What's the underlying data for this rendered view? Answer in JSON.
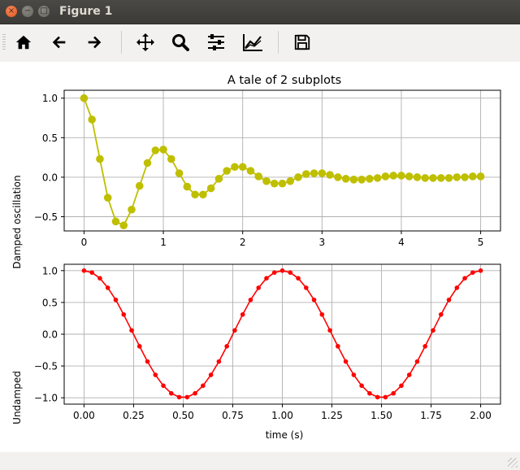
{
  "window": {
    "title": "Figure 1",
    "close_icon": "×",
    "minimize_icon": "−",
    "maximize_icon": "□"
  },
  "toolbar": {
    "buttons": [
      {
        "name": "home",
        "icon": "home-icon"
      },
      {
        "name": "back",
        "icon": "arrow-left-icon"
      },
      {
        "name": "forward",
        "icon": "arrow-right-icon"
      },
      {
        "name": "pan",
        "icon": "move-icon"
      },
      {
        "name": "zoom",
        "icon": "magnifier-icon"
      },
      {
        "name": "subplots",
        "icon": "sliders-icon"
      },
      {
        "name": "edit-axis",
        "icon": "line-chart-icon"
      },
      {
        "name": "save",
        "icon": "floppy-disk-icon"
      }
    ]
  },
  "statusbar": {
    "text": ""
  },
  "chart_data": [
    {
      "type": "line",
      "title": "A tale of 2 subplots",
      "xlabel": "",
      "ylabel": "Damped oscillation",
      "xlim": [
        -0.25,
        5.25
      ],
      "ylim": [
        -0.68,
        1.1
      ],
      "xticks": [
        0,
        1,
        2,
        3,
        4,
        5
      ],
      "xtick_labels": [
        "0",
        "1",
        "2",
        "3",
        "4",
        "5"
      ],
      "yticks": [
        -0.5,
        0.0,
        0.5,
        1.0
      ],
      "ytick_labels": [
        "−0.5",
        "0.0",
        "0.5",
        "1.0"
      ],
      "grid": true,
      "color": "#bfbf00",
      "marker": "circle-large",
      "x": [
        0,
        0.1,
        0.2,
        0.3,
        0.4,
        0.5,
        0.6,
        0.7,
        0.8,
        0.9,
        1.0,
        1.1,
        1.2,
        1.3,
        1.4,
        1.5,
        1.6,
        1.7,
        1.8,
        1.9,
        2.0,
        2.1,
        2.2,
        2.3,
        2.4,
        2.5,
        2.6,
        2.7,
        2.8,
        2.9,
        3.0,
        3.1,
        3.2,
        3.3,
        3.4,
        3.5,
        3.6,
        3.7,
        3.8,
        3.9,
        4.0,
        4.1,
        4.2,
        4.3,
        4.4,
        4.5,
        4.6,
        4.7,
        4.8,
        4.9,
        5.0
      ],
      "y": [
        1.0,
        0.73,
        0.23,
        -0.26,
        -0.56,
        -0.61,
        -0.41,
        -0.11,
        0.18,
        0.34,
        0.35,
        0.23,
        0.05,
        -0.12,
        -0.22,
        -0.22,
        -0.14,
        -0.02,
        0.08,
        0.13,
        0.13,
        0.08,
        0.01,
        -0.05,
        -0.08,
        -0.08,
        -0.05,
        0.0,
        0.04,
        0.05,
        0.05,
        0.03,
        0.0,
        -0.02,
        -0.03,
        -0.03,
        -0.02,
        -0.01,
        0.01,
        0.02,
        0.02,
        0.01,
        0.0,
        -0.01,
        -0.01,
        -0.01,
        -0.01,
        0.0,
        0.0,
        0.01,
        0.01
      ]
    },
    {
      "type": "line",
      "title": "",
      "xlabel": "time (s)",
      "ylabel": "Undamped",
      "xlim": [
        -0.1,
        2.1
      ],
      "ylim": [
        -1.1,
        1.1
      ],
      "xticks": [
        0,
        0.25,
        0.5,
        0.75,
        1.0,
        1.25,
        1.5,
        1.75,
        2.0
      ],
      "xtick_labels": [
        "0.00",
        "0.25",
        "0.50",
        "0.75",
        "1.00",
        "1.25",
        "1.50",
        "1.75",
        "2.00"
      ],
      "yticks": [
        -1.0,
        -0.5,
        0.0,
        0.5,
        1.0
      ],
      "ytick_labels": [
        "−1.0",
        "−0.5",
        "0.0",
        "0.5",
        "1.0"
      ],
      "grid": true,
      "color": "#ff0000",
      "marker": "circle-small",
      "x": [
        0,
        0.04,
        0.08,
        0.12,
        0.16,
        0.2,
        0.24,
        0.28,
        0.32,
        0.36,
        0.4,
        0.44,
        0.48,
        0.52,
        0.56,
        0.6,
        0.64,
        0.68,
        0.72,
        0.76,
        0.8,
        0.84,
        0.88,
        0.92,
        0.96,
        1.0,
        1.04,
        1.08,
        1.12,
        1.16,
        1.2,
        1.24,
        1.28,
        1.32,
        1.36,
        1.4,
        1.44,
        1.48,
        1.52,
        1.56,
        1.6,
        1.64,
        1.68,
        1.72,
        1.76,
        1.8,
        1.84,
        1.88,
        1.92,
        1.96,
        2.0
      ],
      "y": [
        1.0,
        0.97,
        0.88,
        0.73,
        0.54,
        0.31,
        0.06,
        -0.19,
        -0.43,
        -0.64,
        -0.81,
        -0.93,
        -0.99,
        -0.99,
        -0.93,
        -0.81,
        -0.64,
        -0.43,
        -0.19,
        0.06,
        0.31,
        0.54,
        0.73,
        0.88,
        0.97,
        1.0,
        0.97,
        0.88,
        0.73,
        0.54,
        0.31,
        0.06,
        -0.19,
        -0.43,
        -0.64,
        -0.81,
        -0.93,
        -0.99,
        -0.99,
        -0.93,
        -0.81,
        -0.64,
        -0.43,
        -0.19,
        0.06,
        0.31,
        0.54,
        0.73,
        0.88,
        0.97,
        1.0
      ]
    }
  ]
}
